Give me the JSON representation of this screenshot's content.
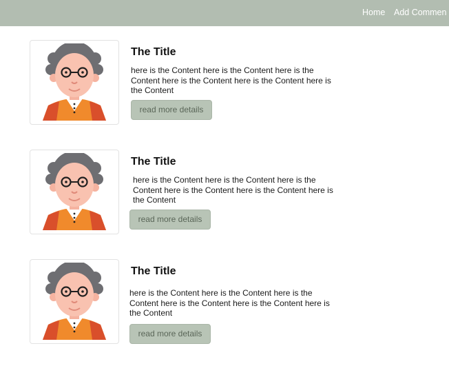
{
  "nav": {
    "home_label": "Home",
    "add_label": "Add Commen"
  },
  "colors": {
    "navbar": "#b2bdb1",
    "button": "#b8c4b6"
  },
  "cards": [
    {
      "title": "The Title",
      "content": "here is the Content here is the Content here is the Content here is the Content here is the Content here is the Content",
      "button_label": "read more details",
      "avatar_icon": "old-man-avatar-icon"
    },
    {
      "title": "The Title",
      "content": "here is the Content here is the Content here is the Content here is the Content here is the Content here is the Content",
      "button_label": "read more details",
      "avatar_icon": "old-man-avatar-icon"
    },
    {
      "title": "The Title",
      "content": "here is the Content here is the Content here is the Content here is the Content here is the Content here is the Content",
      "button_label": "read more details",
      "avatar_icon": "old-man-avatar-icon"
    }
  ]
}
